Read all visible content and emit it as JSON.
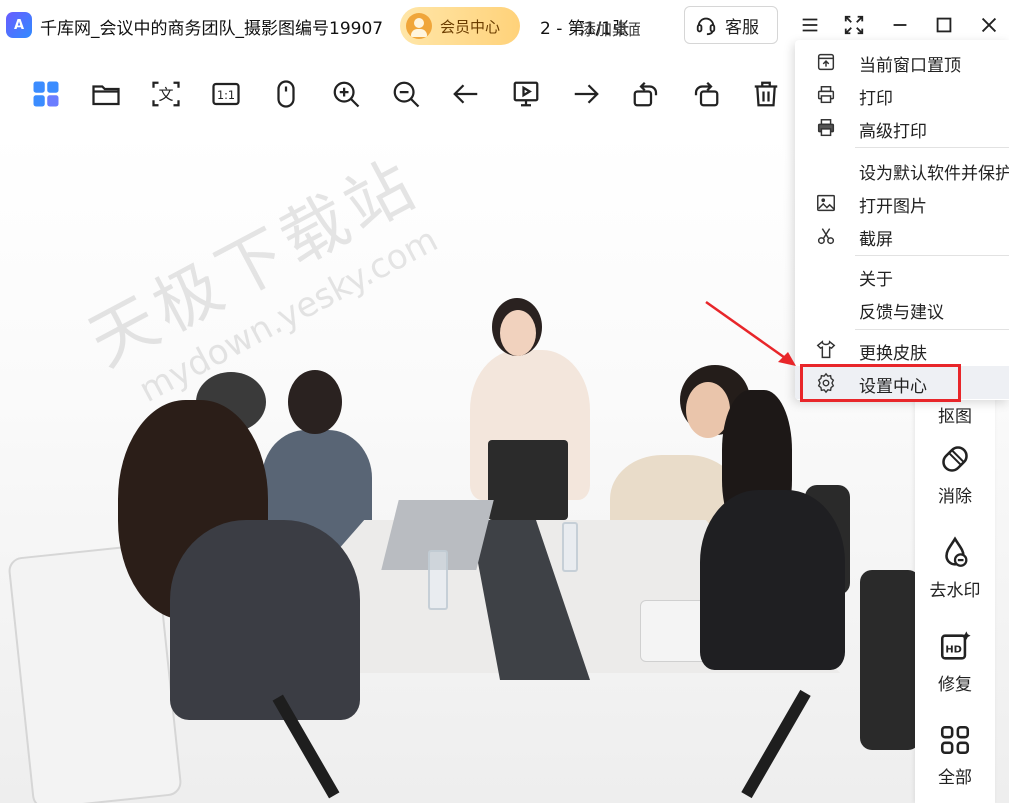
{
  "window": {
    "title_left": "千库网_会议中的商务团队_摄影图编号19907",
    "title_right": "2 - 第1/1张",
    "title_overlap": "添加桌面图标",
    "app_logo": "A",
    "vip_label": "会员中心",
    "service_label": "客服"
  },
  "toolbar": {
    "icons": [
      "apps-icon",
      "folder-icon",
      "text-recognize-icon",
      "actual-size-icon",
      "mouse-icon",
      "zoom-in-icon",
      "zoom-out-icon",
      "previous-icon",
      "slideshow-icon",
      "next-icon",
      "rotate-left-icon",
      "rotate-right-icon",
      "delete-icon"
    ],
    "actual_size_label": "1:1",
    "ocr_label": "文"
  },
  "watermark": {
    "big": "天极下载站",
    "small": "mydown.yesky.com"
  },
  "side_panel": {
    "items": [
      {
        "label": "抠图",
        "icon": "cutout-icon"
      },
      {
        "label": "消除",
        "icon": "eraser-icon"
      },
      {
        "label": "去水印",
        "icon": "remove-watermark-icon"
      },
      {
        "label": "修复",
        "icon": "hd-repair-icon"
      },
      {
        "label": "全部",
        "icon": "all-tools-icon"
      }
    ],
    "hd_text": "HD"
  },
  "menu": {
    "items": [
      {
        "label": "当前窗口置顶",
        "icon": "pin-top-icon"
      },
      {
        "label": "打印",
        "icon": "print-icon"
      },
      {
        "label": "高级打印",
        "icon": "advanced-print-icon"
      },
      {
        "label": "设为默认软件并保护",
        "icon": ""
      },
      {
        "label": "打开图片",
        "icon": "open-image-icon"
      },
      {
        "label": "截屏",
        "icon": "screenshot-icon"
      },
      {
        "label": "关于",
        "icon": ""
      },
      {
        "label": "反馈与建议",
        "icon": ""
      },
      {
        "label": "更换皮肤",
        "icon": "skin-icon"
      },
      {
        "label": "设置中心",
        "icon": "settings-icon"
      }
    ]
  },
  "colors": {
    "highlight_red": "#e8262a",
    "vip_gold": "#ffd27a",
    "logo_blue": "#2f8bff"
  }
}
